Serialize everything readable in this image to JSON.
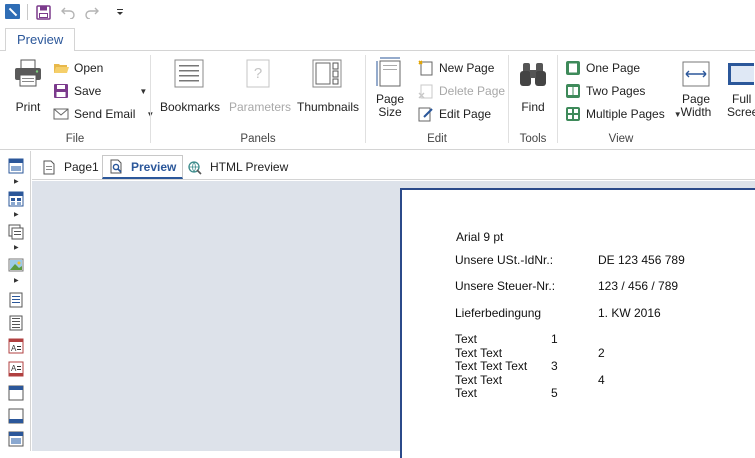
{
  "ribbon_tab": "Preview",
  "file_group": {
    "label": "File",
    "print": "Print",
    "open": "Open",
    "save": "Save",
    "send_email": "Send Email"
  },
  "panels_group": {
    "label": "Panels",
    "bookmarks": "Bookmarks",
    "parameters": "Parameters",
    "thumbnails": "Thumbnails"
  },
  "edit_group": {
    "label": "Edit",
    "page_size_line1": "Page",
    "page_size_line2": "Size",
    "new_page": "New Page",
    "delete_page": "Delete Page",
    "edit_page": "Edit Page"
  },
  "tools_group": {
    "label": "Tools",
    "find": "Find"
  },
  "view_group": {
    "label": "View",
    "one_page": "One Page",
    "two_pages": "Two Pages",
    "multiple_pages": "Multiple Pages",
    "page_width_line1": "Page",
    "page_width_line2": "Width",
    "full_screen_line1": "Full",
    "full_screen_line2": "Screen"
  },
  "doc_tabs": [
    "Page1",
    "Preview",
    "HTML Preview"
  ],
  "report": {
    "font_note": "Arial 9 pt",
    "rows": [
      {
        "label": "Unsere USt.-IdNr.:",
        "value": "DE 123 456 789"
      },
      {
        "label": "Unsere Steuer-Nr.:",
        "value": "123 / 456 / 789"
      },
      {
        "label": "Lieferbedingung",
        "value": "1. KW 2016"
      }
    ],
    "text_rows": [
      {
        "text": "Text",
        "num": "1"
      },
      {
        "text": "Text Text",
        "num": "2"
      },
      {
        "text": "Text Text Text",
        "num": "3"
      },
      {
        "text": "Text Text",
        "num": "4"
      },
      {
        "text": "Text",
        "num": "5"
      }
    ]
  },
  "colors": {
    "accent": "#2b579a",
    "canvas_bg": "#dde2ea",
    "disabled": "#a8a8a8"
  }
}
